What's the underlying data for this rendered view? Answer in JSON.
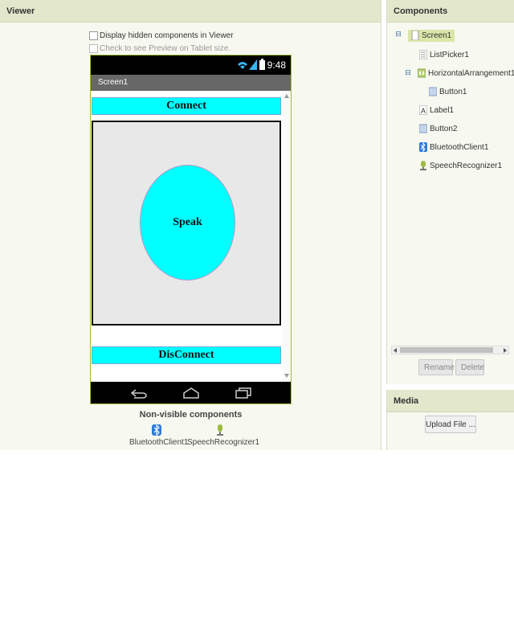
{
  "viewer": {
    "title": "Viewer",
    "display_hidden_label": "Display hidden components in Viewer",
    "tablet_preview_label": "Check to see Preview on Tablet size."
  },
  "phone": {
    "time": "9:48",
    "screen_title": "Screen1",
    "connect_label": "Connect",
    "speak_label": "Speak",
    "disconnect_label": "DisConnect"
  },
  "nonvisible": {
    "title": "Non-visible components",
    "items": [
      {
        "label": "BluetoothClient1",
        "icon": "bluetooth-icon"
      },
      {
        "label": "SpeechRecognizer1",
        "icon": "microphone-icon"
      }
    ]
  },
  "components": {
    "title": "Components",
    "tree": [
      {
        "label": "Screen1",
        "icon": "screen-icon",
        "selected": true
      },
      {
        "label": "ListPicker1",
        "icon": "listpicker-icon"
      },
      {
        "label": "HorizontalArrangement1",
        "icon": "horizontal-arrangement-icon"
      },
      {
        "label": "Button1",
        "icon": "button-icon"
      },
      {
        "label": "Label1",
        "icon": "label-icon"
      },
      {
        "label": "Button2",
        "icon": "button-icon"
      },
      {
        "label": "BluetoothClient1",
        "icon": "bluetooth-icon"
      },
      {
        "label": "SpeechRecognizer1",
        "icon": "microphone-icon"
      }
    ],
    "rename_label": "Rename",
    "delete_label": "Delete"
  },
  "media": {
    "title": "Media",
    "upload_label": "Upload File ..."
  },
  "colors": {
    "accent_cyan": "#00ffff",
    "header_green": "#e3e8cd",
    "selection_green": "#d9e6a8"
  }
}
